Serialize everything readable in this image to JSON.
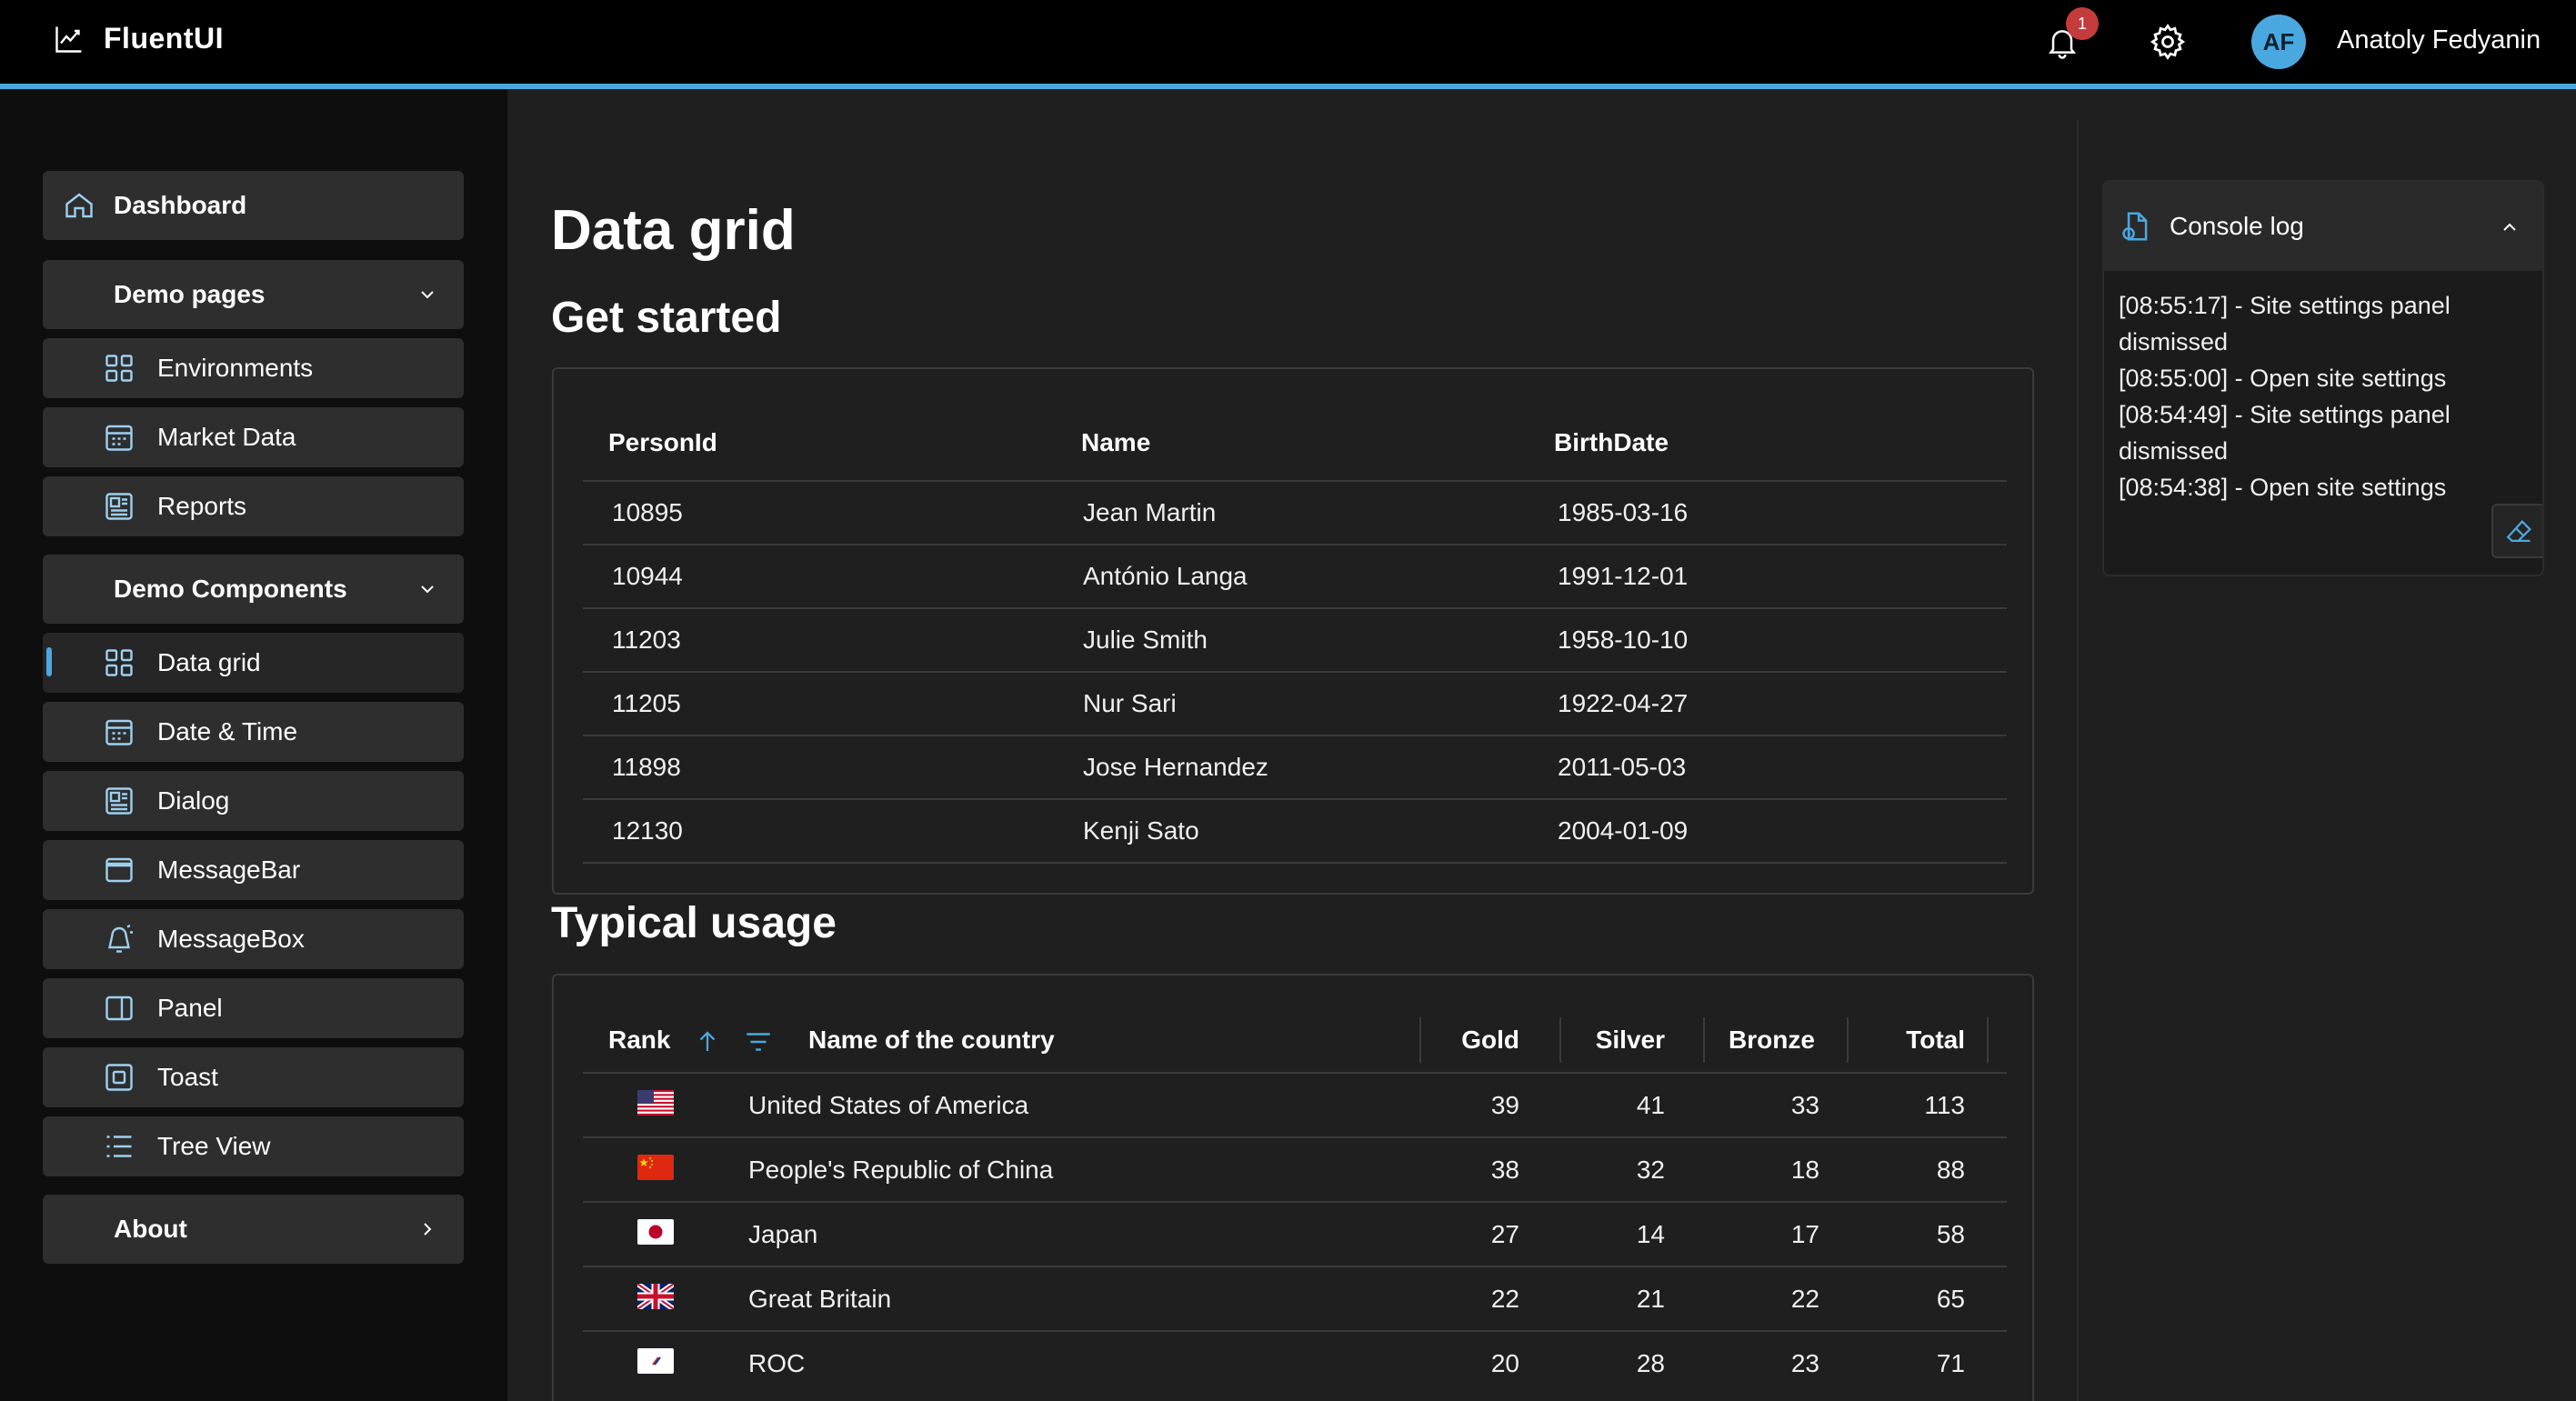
{
  "app": {
    "title": "FluentUI",
    "logo_icon": "chart-line-icon"
  },
  "header": {
    "notification_count": "1",
    "avatar_initials": "AF",
    "user_name": "Anatoly Fedyanin"
  },
  "colors": {
    "accent": "#4aa8e0",
    "badge": "#c43b3b",
    "background": "#1f1f1f",
    "sidebar": "#0e0e0e"
  },
  "sidebar": {
    "dashboard": "Dashboard",
    "demo_pages": "Demo pages",
    "pages": [
      "Environments",
      "Market Data",
      "Reports"
    ],
    "demo_components": "Demo Components",
    "components": [
      "Data grid",
      "Date & Time",
      "Dialog",
      "MessageBar",
      "MessageBox",
      "Panel",
      "Toast",
      "Tree View"
    ],
    "about": "About",
    "selected": "Data grid"
  },
  "main": {
    "title": "Data grid",
    "get_started": "Get started",
    "typical_usage": "Typical usage"
  },
  "people_grid": {
    "columns": [
      "PersonId",
      "Name",
      "BirthDate"
    ],
    "rows": [
      [
        "10895",
        "Jean Martin",
        "1985-03-16"
      ],
      [
        "10944",
        "António Langa",
        "1991-12-01"
      ],
      [
        "11203",
        "Julie Smith",
        "1958-10-10"
      ],
      [
        "11205",
        "Nur Sari",
        "1922-04-27"
      ],
      [
        "11898",
        "Jose Hernandez",
        "2011-05-03"
      ],
      [
        "12130",
        "Kenji Sato",
        "2004-01-09"
      ]
    ]
  },
  "medal_grid": {
    "columns": [
      "Rank",
      "Name of the country",
      "Gold",
      "Silver",
      "Bronze",
      "Total"
    ],
    "rows": [
      {
        "flag": "us-flag",
        "country": "United States of America",
        "gold": "39",
        "silver": "41",
        "bronze": "33",
        "total": "113"
      },
      {
        "flag": "cn-flag",
        "country": "People's Republic of China",
        "gold": "38",
        "silver": "32",
        "bronze": "18",
        "total": "88"
      },
      {
        "flag": "jp-flag",
        "country": "Japan",
        "gold": "27",
        "silver": "14",
        "bronze": "17",
        "total": "58"
      },
      {
        "flag": "gb-flag",
        "country": "Great Britain",
        "gold": "22",
        "silver": "21",
        "bronze": "22",
        "total": "65"
      },
      {
        "flag": "roc-flag",
        "country": "ROC",
        "gold": "20",
        "silver": "28",
        "bronze": "23",
        "total": "71"
      }
    ]
  },
  "console": {
    "title": "Console log",
    "lines": [
      "[08:55:17] - Site settings panel dismissed",
      "[08:55:00] - Open site settings",
      "[08:54:49] - Site settings panel dismissed",
      "[08:54:38] - Open site settings"
    ]
  }
}
